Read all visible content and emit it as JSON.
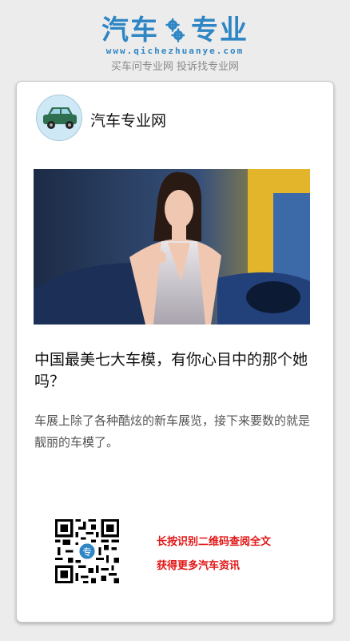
{
  "header": {
    "logo_left": "汽车",
    "logo_right": "专业",
    "url": "www.qichezhuanye.com",
    "slogan": "买车问专业网 投诉找专业网",
    "brand_color": "#2f86c4"
  },
  "card": {
    "site_name": "汽车专业网",
    "avatar_icon": "car-icon",
    "title": "中国最美七大车模，有你心目中的那个她吗？",
    "summary": "车展上除了各种酷炫的新车展览，接下来要数的就是靓丽的车模了。",
    "qr_icon": "qr-code-icon",
    "cta_line1": "长按识别二维码查阅全文",
    "cta_line2": "获得更多汽车资讯",
    "cta_color": "#e21515"
  }
}
